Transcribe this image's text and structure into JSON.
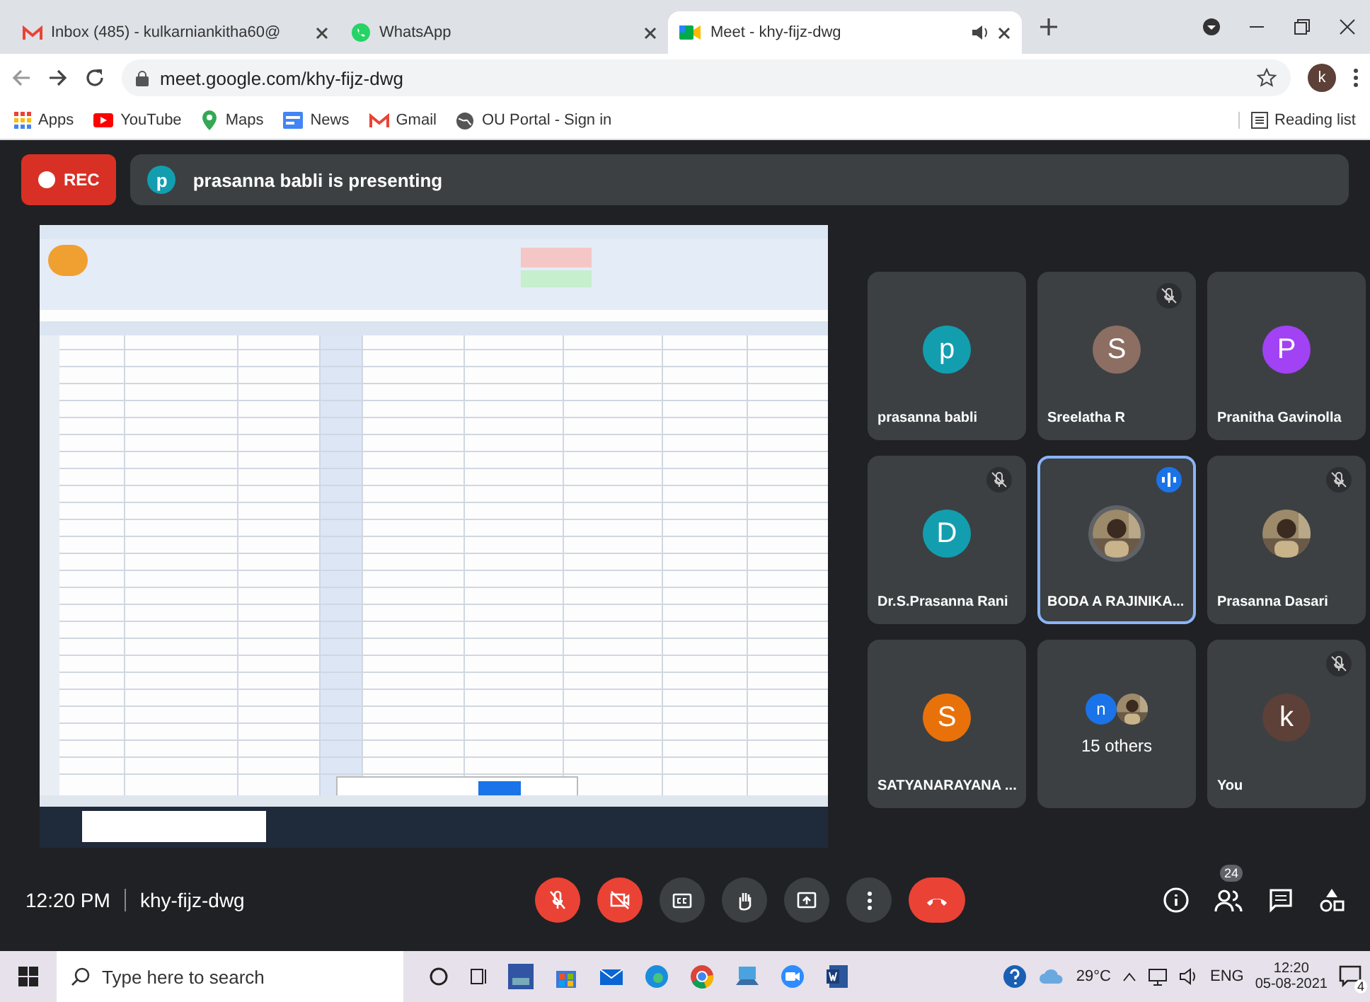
{
  "browser": {
    "tabs": [
      {
        "kind": "gmail",
        "title": "Inbox (485) - kulkarniankitha60@",
        "selected": false,
        "audio": false
      },
      {
        "kind": "whatsapp",
        "title": "WhatsApp",
        "selected": false,
        "audio": false
      },
      {
        "kind": "meet",
        "title": "Meet - khy-fijz-dwg",
        "selected": true,
        "audio": true
      }
    ],
    "address": "meet.google.com/khy-fijz-dwg",
    "profile": "k",
    "bookmarks": [
      {
        "kind": "apps",
        "label": "Apps"
      },
      {
        "kind": "youtube",
        "label": "YouTube"
      },
      {
        "kind": "maps",
        "label": "Maps"
      },
      {
        "kind": "news",
        "label": "News"
      },
      {
        "kind": "gmail",
        "label": "Gmail"
      },
      {
        "kind": "globe",
        "label": "OU Portal - Sign in"
      }
    ],
    "reading_list": "Reading list"
  },
  "meet": {
    "rec": "REC",
    "presenter": {
      "initial": "p",
      "color": "#129eaf",
      "text": "prasanna babli is presenting"
    },
    "tiles": [
      {
        "kind": "letter",
        "letter": "p",
        "color": "#129eaf",
        "name": "prasanna babli",
        "muted": false,
        "speaking": false
      },
      {
        "kind": "letter",
        "letter": "S",
        "color": "#8d6e63",
        "name": "Sreelatha R",
        "muted": true,
        "speaking": false
      },
      {
        "kind": "letter",
        "letter": "P",
        "color": "#a142f4",
        "name": "Pranitha Gavinolla",
        "muted": false,
        "speaking": false
      },
      {
        "kind": "letter",
        "letter": "D",
        "color": "#129eaf",
        "name": "Dr.S.Prasanna Rani",
        "muted": true,
        "speaking": false
      },
      {
        "name": "BODA A RAJINIKA...",
        "muted": false,
        "speaking": true
      },
      {
        "name": "Prasanna Dasari",
        "muted": true,
        "speaking": false
      },
      {
        "kind": "letter",
        "letter": "S",
        "color": "#e8710a",
        "name": "SATYANARAYANA ...",
        "muted": false,
        "speaking": false
      },
      {
        "kind": "others",
        "letter": "n",
        "color": "#1a73e8",
        "name": "15 others",
        "muted": false,
        "speaking": false
      },
      {
        "kind": "letter",
        "letter": "k",
        "color": "#5d4037",
        "name": "You",
        "muted": true,
        "speaking": false
      }
    ],
    "time": "12:20 PM",
    "code": "khy-fijz-dwg",
    "controls": [
      {
        "kind": "mic",
        "active": true
      },
      {
        "kind": "camera",
        "active": true
      },
      {
        "kind": "captions",
        "active": false
      },
      {
        "kind": "hand",
        "active": false
      },
      {
        "kind": "present",
        "active": false
      },
      {
        "kind": "more",
        "active": false
      },
      {
        "kind": "hangup",
        "active": true
      }
    ],
    "people_count": "24"
  },
  "taskbar": {
    "search": "Type here to search",
    "temperature": "29°C",
    "language": "ENG",
    "time": "12:20",
    "date": "05-08-2021",
    "notifications": "4"
  }
}
